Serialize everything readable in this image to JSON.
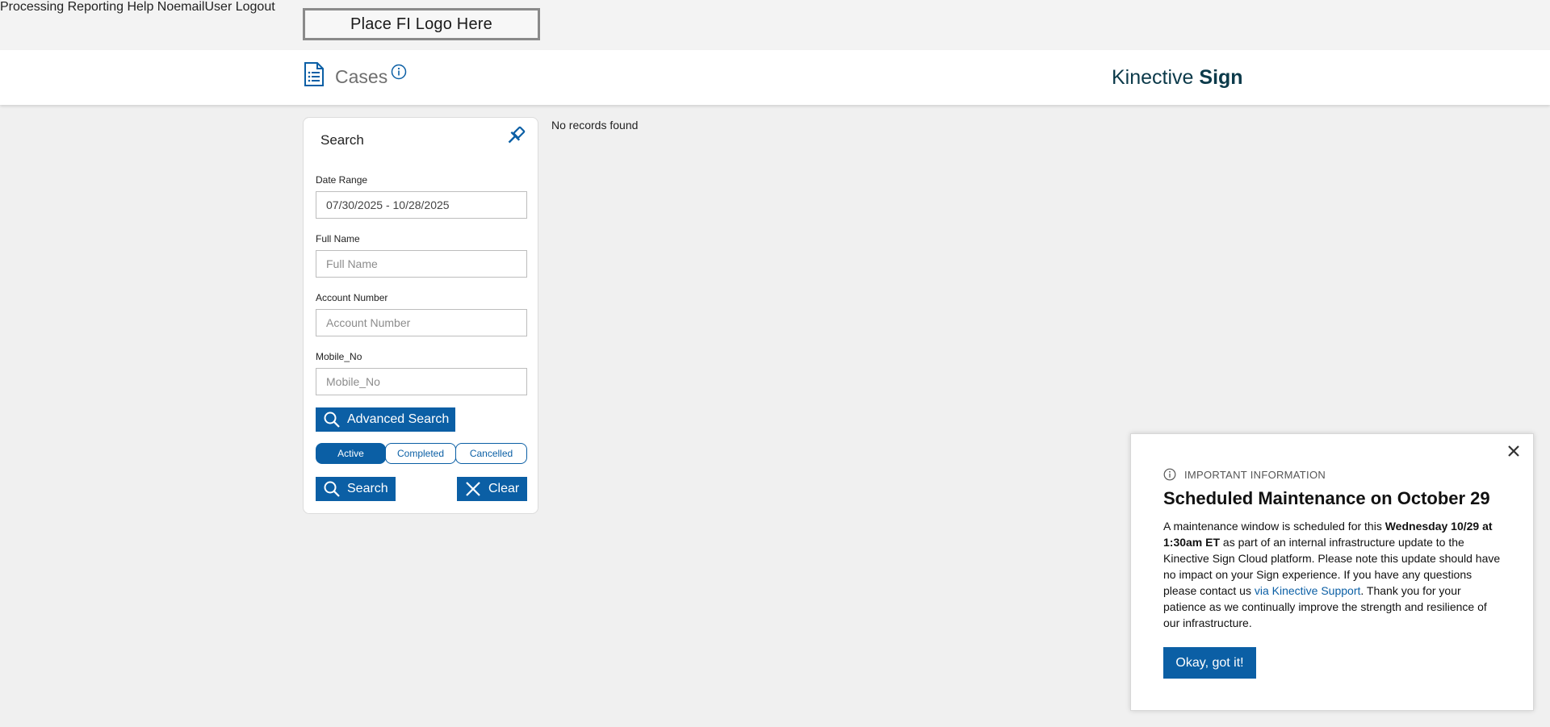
{
  "topbar": {
    "logo_text": "Place FI Logo Here",
    "nav": [
      "Processing",
      "Reporting",
      "Help",
      "NoemailUser",
      "Logout"
    ]
  },
  "header": {
    "title": "Cases",
    "brand_light": "Kinective ",
    "brand_bold": "Sign"
  },
  "search": {
    "title": "Search",
    "date_range": {
      "label": "Date Range",
      "value": "07/30/2025 - 10/28/2025"
    },
    "full_name": {
      "label": "Full Name",
      "placeholder": "Full Name"
    },
    "account_number": {
      "label": "Account Number",
      "placeholder": "Account Number"
    },
    "mobile_no": {
      "label": "Mobile_No",
      "placeholder": "Mobile_No"
    },
    "advanced_search_label": "Advanced Search",
    "status_tabs": [
      "Active",
      "Completed",
      "Cancelled"
    ],
    "active_status": "Active",
    "search_label": "Search",
    "clear_label": "Clear"
  },
  "results": {
    "empty_text": "No records found"
  },
  "modal": {
    "kicker": "IMPORTANT INFORMATION",
    "title": "Scheduled Maintenance on October 29",
    "body_1": "A maintenance window is scheduled for this ",
    "body_bold": "Wednesday 10/29 at 1:30am ET",
    "body_2": " as part of an internal infrastructure update to the Kinective Sign Cloud platform. Please note this update should have no impact on your Sign experience. If you have any questions please contact us ",
    "body_link": "via Kinective Support",
    "body_3": ". Thank you for your patience as we continually improve the strength and resilience of our infrastructure.",
    "ok_label": "Okay, got it!"
  },
  "colors": {
    "primary": "#0b5fa5",
    "brand_text": "#0c3a4a",
    "page_bg": "#f0f0f0"
  }
}
